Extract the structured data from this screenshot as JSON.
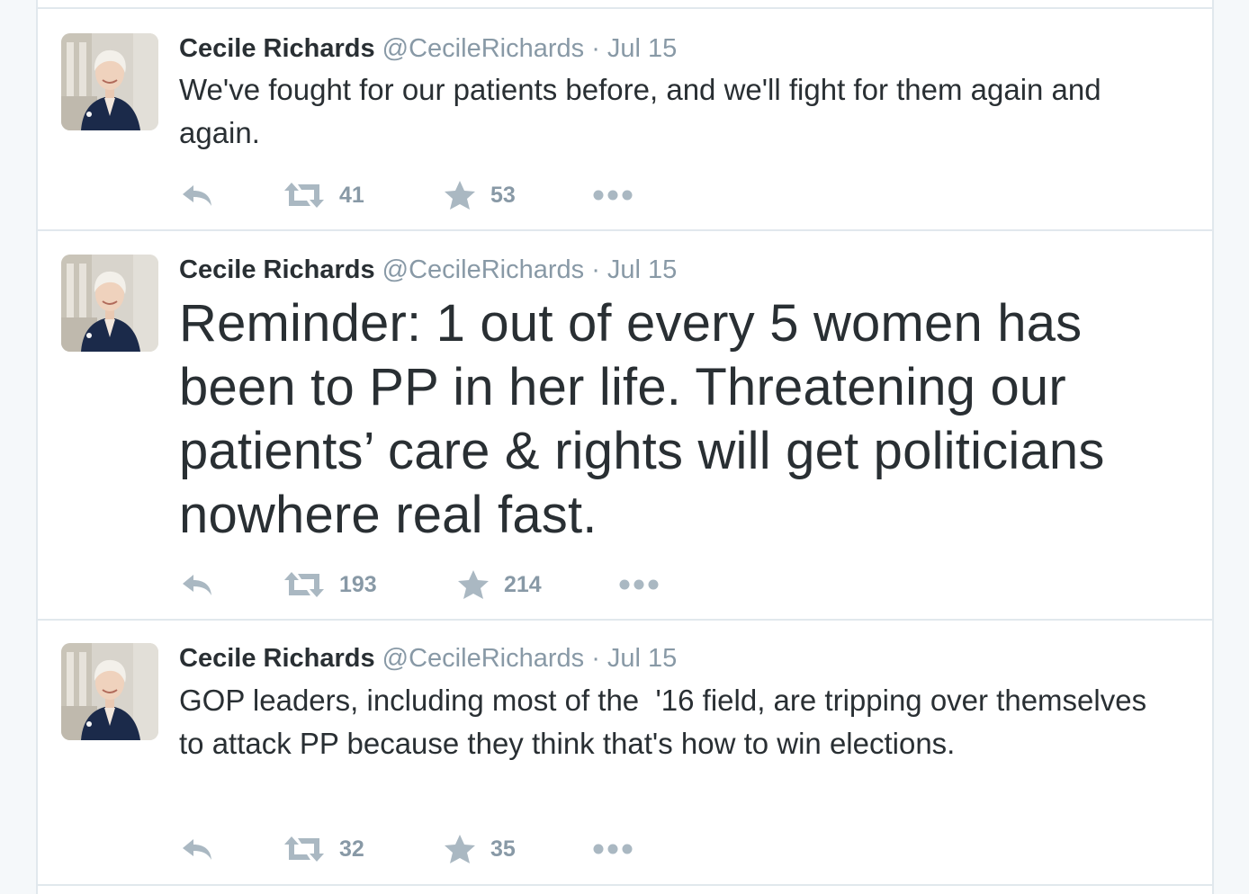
{
  "tweets": [
    {
      "fullname": "Cecile Richards",
      "handle": "@CecileRichards",
      "separator": "·",
      "date": "Jul 15",
      "text": "We've fought for our patients before, and we'll fight for them again and again.",
      "retweets": "41",
      "favorites": "53"
    },
    {
      "fullname": "Cecile Richards",
      "handle": "@CecileRichards",
      "separator": "·",
      "date": "Jul 15",
      "text": "Reminder: 1 out of every 5 women has been to PP in her life. Threatening our patients’ care & rights will get politicians nowhere real fast.",
      "retweets": "193",
      "favorites": "214"
    },
    {
      "fullname": "Cecile Richards",
      "handle": "@CecileRichards",
      "separator": "·",
      "date": "Jul 15",
      "text": "GOP leaders, including most of the  '16 field, are tripping over themselves to attack PP because they think that's how to win elections.",
      "retweets": "32",
      "favorites": "35"
    }
  ],
  "icons": {
    "reply": "reply-icon",
    "retweet": "retweet-icon",
    "favorite": "star-icon",
    "more": "more-dots-icon"
  },
  "colors": {
    "name": "#292f33",
    "meta": "#8899a6",
    "icon": "#aab8c2",
    "border": "#e1e8ed",
    "avatar_jacket": "#1b2a4a"
  }
}
